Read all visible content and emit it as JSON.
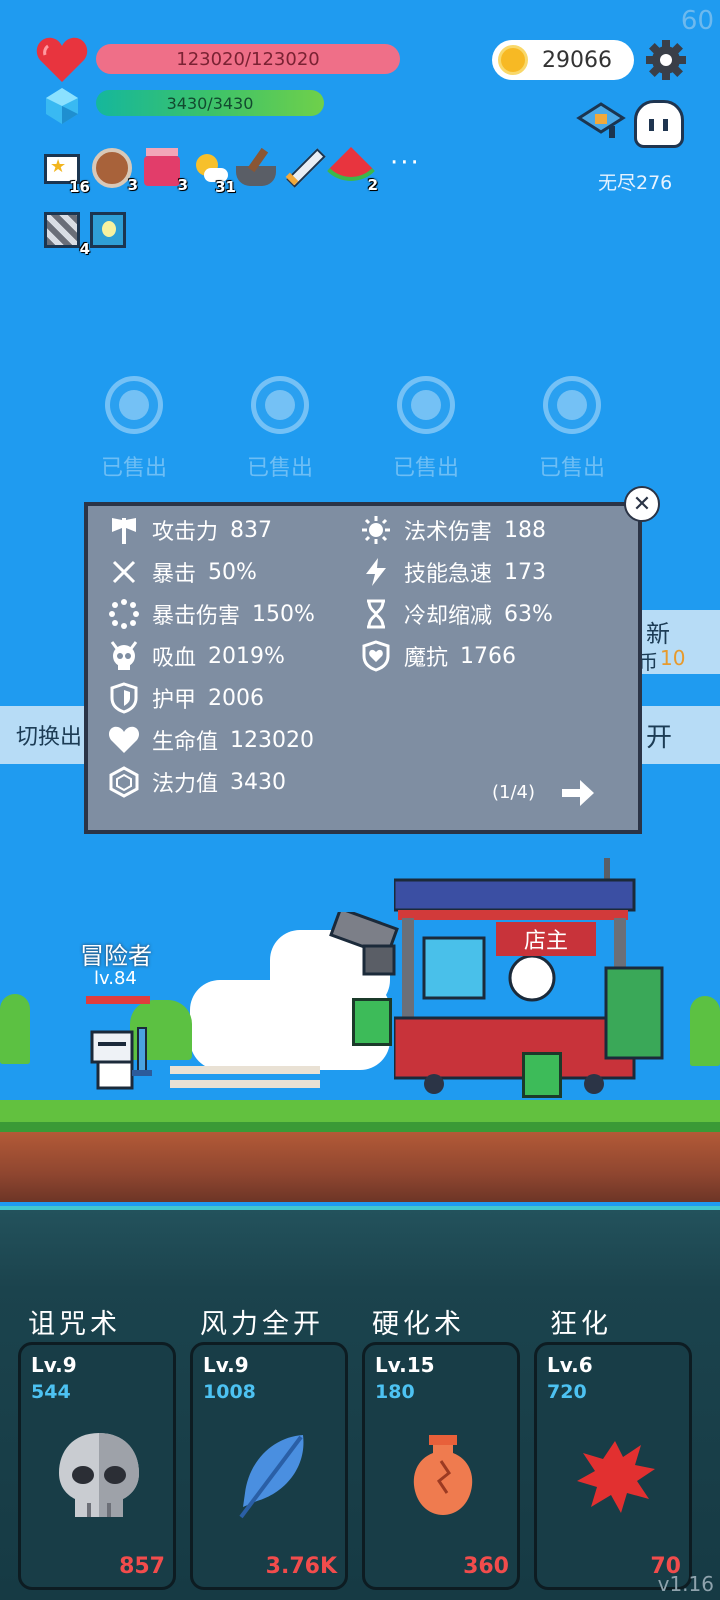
{
  "fps": "60",
  "hud": {
    "hp_text": "123020/123020",
    "mp_text": "3430/3430",
    "gold": "29066",
    "endless_label": "无尽276"
  },
  "items": [
    {
      "name": "star-card-icon",
      "count": "16"
    },
    {
      "name": "shield-round-icon",
      "count": "3"
    },
    {
      "name": "jam-jar-icon",
      "count": "3"
    },
    {
      "name": "sun-cloud-icon",
      "count": "31"
    },
    {
      "name": "mortar-icon",
      "count": ""
    },
    {
      "name": "sword-icon",
      "count": ""
    },
    {
      "name": "watermelon-icon",
      "count": "2"
    },
    {
      "name": "striped-scroll-icon",
      "count": "4"
    },
    {
      "name": "lightbulb-card-icon",
      "count": ""
    }
  ],
  "more_label": "···",
  "shop_slots": [
    {
      "label": "已售出"
    },
    {
      "label": "已售出"
    },
    {
      "label": "已售出"
    },
    {
      "label": "已售出"
    }
  ],
  "side": {
    "left_label": "切换出",
    "right_top_label": "新",
    "right_top_sub": "币",
    "right_top_value": "10",
    "right_bottom_label": "开"
  },
  "stats_panel": {
    "left": [
      {
        "icon": "attack-axe-icon",
        "label": "攻击力",
        "value": "837"
      },
      {
        "icon": "crit-cross-icon",
        "label": "暴击",
        "value": "50%"
      },
      {
        "icon": "crit-damage-icon",
        "label": "暴击伤害",
        "value": "150%"
      },
      {
        "icon": "lifesteal-skull-icon",
        "label": "吸血",
        "value": "2019%"
      },
      {
        "icon": "armor-shield-icon",
        "label": "护甲",
        "value": "2006"
      },
      {
        "icon": "health-heart-icon",
        "label": "生命值",
        "value": "123020"
      },
      {
        "icon": "mana-gem-icon",
        "label": "法力值",
        "value": "3430"
      }
    ],
    "right": [
      {
        "icon": "spell-sun-icon",
        "label": "法术伤害",
        "value": "188"
      },
      {
        "icon": "haste-bolt-icon",
        "label": "技能急速",
        "value": "173"
      },
      {
        "icon": "cooldown-hourglass-icon",
        "label": "冷却缩减",
        "value": "63%"
      },
      {
        "icon": "magic-resist-icon",
        "label": "魔抗",
        "value": "1766"
      }
    ],
    "page": "(1/4)"
  },
  "scene": {
    "adventurer_name": "冒险者",
    "adventurer_level": "lv.84",
    "shop_sign": "店主"
  },
  "skills": [
    {
      "title": "诅咒术",
      "level": "Lv.9",
      "cost": "544",
      "damage": "857",
      "icon": "skull-icon"
    },
    {
      "title": "风力全开",
      "level": "Lv.9",
      "cost": "1008",
      "damage": "3.76K",
      "icon": "feather-icon"
    },
    {
      "title": "硬化术",
      "level": "Lv.15",
      "cost": "180",
      "damage": "360",
      "icon": "cracked-vase-icon"
    },
    {
      "title": "狂化",
      "level": "Lv.6",
      "cost": "720",
      "damage": "70",
      "icon": "red-splat-icon"
    }
  ],
  "version": "v1.16",
  "colors": {
    "sky": "#1f9bf0",
    "hp_bar": "#ef6f88",
    "panel_bg": "#7f8ea2",
    "skill_card": "#183d47",
    "cost_blue": "#4dc2f2",
    "damage_red": "#f24c4c"
  }
}
